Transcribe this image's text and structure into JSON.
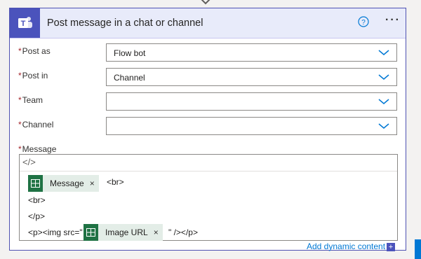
{
  "action": {
    "title": "Post message in a chat or channel",
    "app_icon": "teams-icon",
    "colors": {
      "brand": "#4b53bc",
      "header_bg": "#e8ebfa",
      "required": "#a4262c",
      "link": "#0078d4",
      "excel": "#1f7244"
    }
  },
  "fields": {
    "post_as": {
      "required_mark": "*",
      "label": "Post as",
      "value": "Flow bot"
    },
    "post_in": {
      "required_mark": "*",
      "label": "Post in",
      "value": "Channel"
    },
    "team": {
      "required_mark": "*",
      "label": "Team",
      "value": ""
    },
    "channel": {
      "required_mark": "*",
      "label": "Channel",
      "value": ""
    },
    "message": {
      "required_mark": "*",
      "label": "Message"
    }
  },
  "editor": {
    "code_view_label": "</>",
    "line1_token": "Message",
    "line1_suffix": "<br>",
    "line2": "<br>",
    "line3": "</p>",
    "line4_prefix": "<p><img src=\"",
    "line4_token": "Image URL",
    "line4_suffix": "\" /></p>",
    "token_remove": "×"
  },
  "dynamic_content": {
    "label": "Add dynamic content",
    "plus": "+"
  }
}
